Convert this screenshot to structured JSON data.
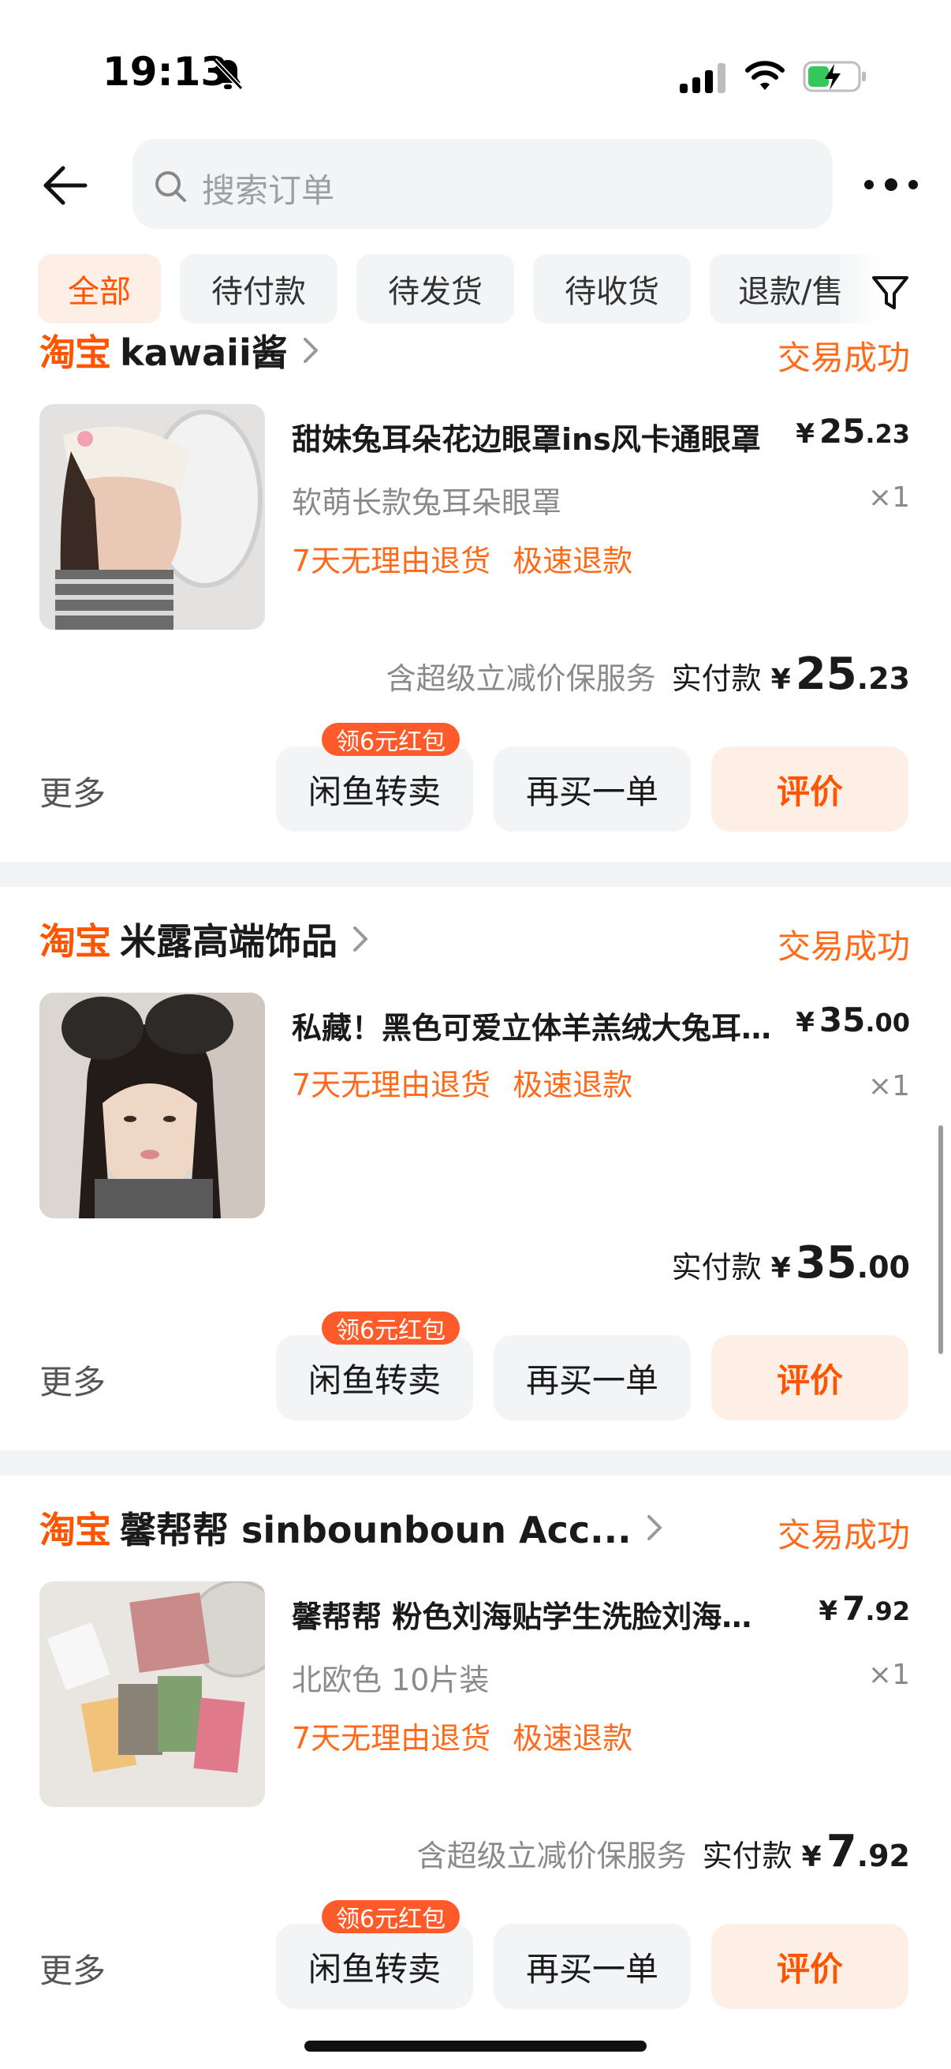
{
  "status_bar": {
    "time": "19:13",
    "icons": [
      "bell-slash-icon",
      "signal-icon",
      "wifi-icon",
      "battery-charging-icon"
    ]
  },
  "header": {
    "search_placeholder": "搜索订单",
    "back_icon": "arrow-left-icon",
    "more_icon": "more-dots-icon"
  },
  "tabs": [
    {
      "label": "全部",
      "active": true
    },
    {
      "label": "待付款",
      "active": false
    },
    {
      "label": "待发货",
      "active": false
    },
    {
      "label": "待收货",
      "active": false
    },
    {
      "label": "退款/售",
      "active": false
    }
  ],
  "orders": [
    {
      "brand": "淘宝",
      "store": "kawaii酱",
      "status": "交易成功",
      "title": "甜妹兔耳朵花边眼罩ins风卡通眼罩",
      "price_int": "25",
      "price_dec": ".23",
      "sku": "软萌长款兔耳朵眼罩",
      "qty": "×1",
      "tags": [
        "7天无理由退货",
        "极速退款"
      ],
      "service": "含超级立减价保服务",
      "total_label": "实付款",
      "currency": "¥",
      "total_int": "25",
      "total_dec": ".23",
      "more": "更多",
      "badge": "领6元红包",
      "btn_resell": "闲鱼转卖",
      "btn_rebuy": "再买一单",
      "btn_rate": "评价"
    },
    {
      "brand": "淘宝",
      "store": "米露高端饰品",
      "status": "交易成功",
      "title": "私藏！黑色可爱立体羊羔绒大兔耳朵发箍",
      "price_int": "35",
      "price_dec": ".00",
      "sku": "",
      "qty": "×1",
      "tags": [
        "7天无理由退货",
        "极速退款"
      ],
      "service": "",
      "total_label": "实付款",
      "currency": "¥",
      "total_int": "35",
      "total_dec": ".00",
      "more": "更多",
      "badge": "领6元红包",
      "btn_resell": "闲鱼转卖",
      "btn_rebuy": "再买一单",
      "btn_rate": "评价"
    },
    {
      "brand": "淘宝",
      "store": "馨帮帮 sinbounboun Acc...",
      "status": "交易成功",
      "title": "馨帮帮 粉色刘海贴学生洗脸刘海贴发帖",
      "price_int": "7",
      "price_dec": ".92",
      "sku": "北欧色 10片装",
      "qty": "×1",
      "tags": [
        "7天无理由退货",
        "极速退款"
      ],
      "service": "含超级立减价保服务",
      "total_label": "实付款",
      "currency": "¥",
      "total_int": "7",
      "total_dec": ".92",
      "more": "更多",
      "badge": "领6元红包",
      "btn_resell": "闲鱼转卖",
      "btn_rebuy": "再买一单",
      "btn_rate": "评价"
    }
  ],
  "colors": {
    "accent": "#ff5500",
    "status_orange": "#ff6a1a",
    "badge_red": "#ff5a2a",
    "page_bg": "#f3f4f6"
  }
}
